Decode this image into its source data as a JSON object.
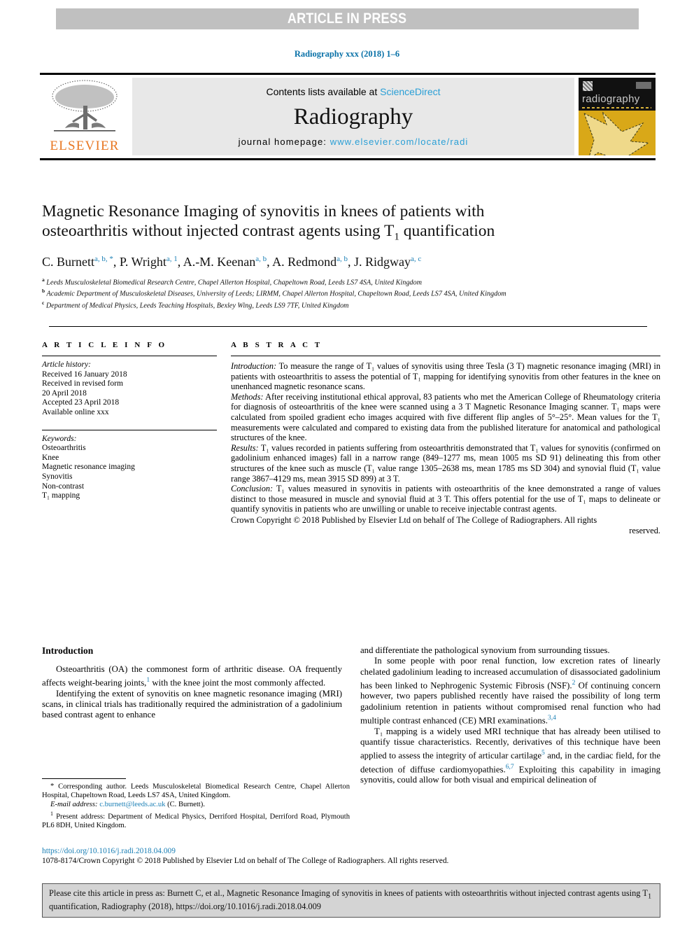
{
  "banner": {
    "text": "ARTICLE IN PRESS"
  },
  "running_head": "Radiography xxx (2018) 1–6",
  "masthead": {
    "publisher_name": "ELSEVIER",
    "contents_prefix": "Contents lists available at ",
    "contents_link": "ScienceDirect",
    "journal_title": "Radiography",
    "homepage_prefix": "journal homepage: ",
    "homepage_url": "www.elsevier.com/locate/radi",
    "cover_journal_name": "radiography"
  },
  "article": {
    "title_line1": "Magnetic Resonance Imaging of synovitis in knees of patients with",
    "title_line2_a": "osteoarthritis without injected contrast agents using T",
    "title_sub": "1",
    "title_line2_b": " quantification",
    "authors": [
      {
        "name": "C. Burnett",
        "marks": "a, b, *"
      },
      {
        "name": "P. Wright",
        "marks": "a, 1"
      },
      {
        "name": "A.-M. Keenan",
        "marks": "a, b"
      },
      {
        "name": "A. Redmond",
        "marks": "a, b"
      },
      {
        "name": "J. Ridgway",
        "marks": "a, c"
      }
    ],
    "affiliations": [
      {
        "mark": "a",
        "text": "Leeds Musculoskeletal Biomedical Research Centre, Chapel Allerton Hospital, Chapeltown Road, Leeds LS7 4SA, United Kingdom"
      },
      {
        "mark": "b",
        "text": "Academic Department of Musculoskeletal Diseases, University of Leeds; LIRMM, Chapel Allerton Hospital, Chapeltown Road, Leeds LS7 4SA, United Kingdom"
      },
      {
        "mark": "c",
        "text": "Department of Medical Physics, Leeds Teaching Hospitals, Bexley Wing, Leeds LS9 7TF, United Kingdom"
      }
    ]
  },
  "article_info": {
    "heading": "A R T I C L E    I N F O",
    "history_label": "Article history:",
    "history_lines": [
      "Received 16 January 2018",
      "Received in revised form",
      "20 April 2018",
      "Accepted 23 April 2018",
      "Available online xxx"
    ],
    "keywords_label": "Keywords:",
    "keywords": [
      "Osteoarthritis",
      "Knee",
      "Magnetic resonance imaging",
      "Synovitis",
      "Non-contrast",
      "T₁ mapping"
    ]
  },
  "abstract": {
    "heading": "A B S T R A C T",
    "introduction_label": "Introduction:",
    "introduction_text": " To measure the range of T₁ values of synovitis using three Tesla (3 T) magnetic resonance imaging (MRI) in patients with osteoarthritis to assess the potential of T₁ mapping for identifying synovitis from other features in the knee on unenhanced magnetic resonance scans.",
    "methods_label": "Methods:",
    "methods_text": " After receiving institutional ethical approval, 83 patients who met the American College of Rheumatology criteria for diagnosis of osteoarthritis of the knee were scanned using a 3 T Magnetic Resonance Imaging scanner. T₁ maps were calculated from spoiled gradient echo images acquired with five different flip angles of 5°–25°. Mean values for the T₁ measurements were calculated and compared to existing data from the published literature for anatomical and pathological structures of the knee.",
    "results_label": "Results:",
    "results_text": " T₁ values recorded in patients suffering from osteoarthritis demonstrated that T₁ values for synovitis (confirmed on gadolinium enhanced images) fall in a narrow range (849–1277 ms, mean 1005 ms SD 91) delineating this from other structures of the knee such as muscle (T₁ value range 1305–2638 ms, mean 1785 ms SD 304) and synovial fluid (T₁ value range 3867–4129 ms, mean 3915 SD 899) at 3 T.",
    "conclusion_label": "Conclusion:",
    "conclusion_text": " T₁ values measured in synovitis in patients with osteoarthritis of the knee demonstrated a range of values distinct to those measured in muscle and synovial fluid at 3 T. This offers potential for the use of T₁ maps to delineate or quantify synovitis in patients who are unwilling or unable to receive injectable contrast agents.",
    "copyright_line": "Crown Copyright © 2018 Published by Elsevier Ltd on behalf of The College of Radiographers. All rights",
    "copyright_tail": "reserved."
  },
  "body": {
    "intro_heading": "Introduction",
    "left_paragraphs": [
      {
        "text_a": "Osteoarthritis (OA) the commonest form of arthritic disease. OA frequently affects weight-bearing joints,",
        "ref": "1",
        "text_b": " with the knee joint the most commonly affected."
      },
      {
        "text_a": "Identifying the extent of synovitis on knee magnetic resonance imaging (MRI) scans, in clinical trials has traditionally required the administration of a gadolinium based contrast agent to enhance",
        "ref": "",
        "text_b": ""
      }
    ],
    "right_paragraphs": [
      {
        "noindent": true,
        "text_a": "and differentiate the pathological synovium from surrounding tissues.",
        "ref": "",
        "text_b": ""
      },
      {
        "noindent": false,
        "text_a": "In some people with poor renal function, low excretion rates of linearly chelated gadolinium leading to increased accumulation of disassociated gadolinium has been linked to Nephrogenic Systemic Fibrosis (NSF).",
        "ref": "2",
        "text_b": " Of continuing concern however, two papers published recently have raised the possibility of long term gadolinium retention in patients without compromised renal function who had multiple contrast enhanced (CE) MRI examinations.",
        "ref2": "3,4"
      },
      {
        "noindent": false,
        "text_a": "T₁ mapping is a widely used MRI technique that has already been utilised to quantify tissue characteristics. Recently, derivatives of this technique have been applied to assess the integrity of articular cartilage",
        "ref": "5",
        "text_b": " and, in the cardiac field, for the detection of diffuse cardiomyopathies.",
        "ref2": "6,7",
        "text_c": " Exploiting this capability in imaging synovitis, could allow for both visual and empirical delineation of"
      }
    ]
  },
  "footnotes": {
    "corresponding_star": "*",
    "corresponding_text": " Corresponding author. Leeds Musculoskeletal Biomedical Research Centre, Chapel Allerton Hospital, Chapeltown Road, Leeds LS7 4SA, United Kingdom.",
    "email_label": "E-mail address:",
    "email_link": "c.burnett@leeds.ac.uk",
    "email_tail": " (C. Burnett).",
    "present_mark": "1",
    "present_text": " Present address: Department of Medical Physics, Derriford Hospital, Derriford Road, Plymouth PL6 8DH, United Kingdom."
  },
  "bottom": {
    "doi": "https://doi.org/10.1016/j.radi.2018.04.009",
    "copyright": "1078-8174/Crown Copyright © 2018 Published by Elsevier Ltd on behalf of The College of Radiographers. All rights reserved."
  },
  "cite_box": {
    "line1": "Please cite this article in press as: Burnett C, et al., Magnetic Resonance Imaging of synovitis in knees of patients with osteoarthritis without",
    "line2_a": "injected contrast agents using T",
    "line2_sub": "1",
    "line2_b": " quantification, Radiography (2018), https://doi.org/10.1016/j.radi.2018.04.009"
  },
  "colors": {
    "link_blue": "#1a7fb5",
    "sciencedirect_blue": "#2a9fd6",
    "elsevier_orange": "#e87722",
    "banner_gray": "#c0c0c0",
    "cover_yellow": "#d9a818"
  }
}
